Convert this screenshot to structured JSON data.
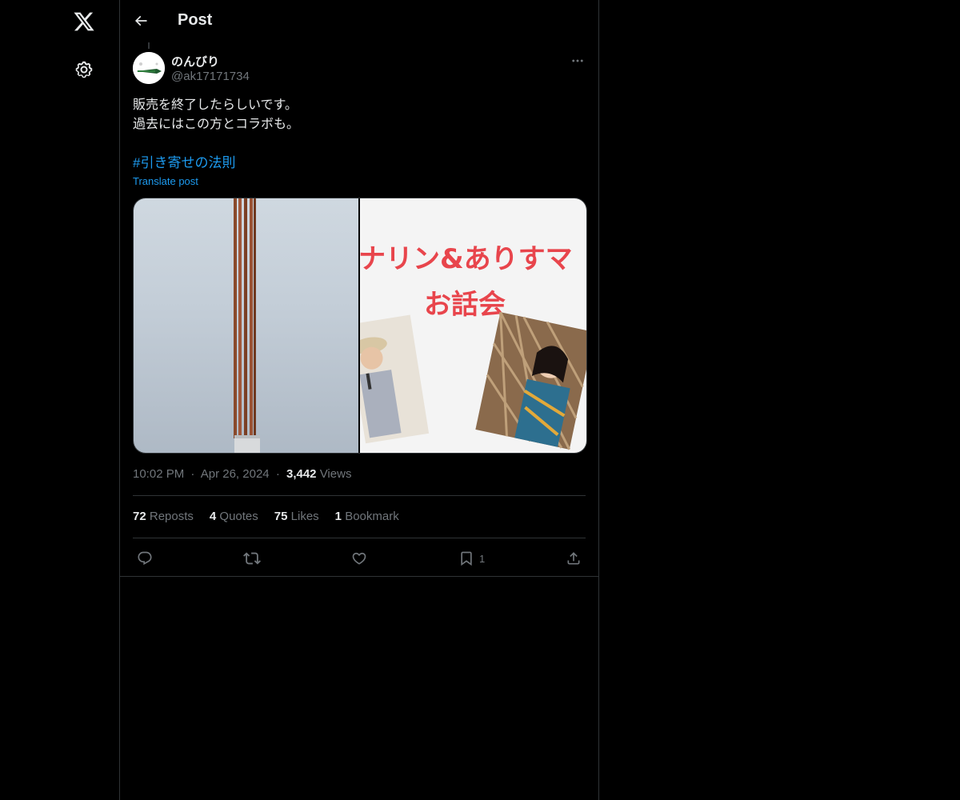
{
  "nav": {
    "logo_icon": "x-logo-icon",
    "settings_icon": "gear-icon"
  },
  "header": {
    "title": "Post"
  },
  "post": {
    "author_name": "のんびり",
    "author_handle": "@ak17171734",
    "text_lines": [
      "販売を終了したらしいです。",
      "過去にはこの方とコラボも。"
    ],
    "hashtag": "#引き寄せの法則",
    "translate_label": "Translate post",
    "media_right_text_line1": "ナリン&ありすマ",
    "media_right_text_line2": "お話会",
    "time": "10:02 PM",
    "date": "Apr 26, 2024",
    "views_count": "3,442",
    "views_label": "Views",
    "separator": "·"
  },
  "stats": {
    "reposts_count": "72",
    "reposts_label": "Reposts",
    "quotes_count": "4",
    "quotes_label": "Quotes",
    "likes_count": "75",
    "likes_label": "Likes",
    "bookmarks_count": "1",
    "bookmarks_label": "Bookmark"
  },
  "actions": {
    "bookmark_count": "1"
  },
  "colors": {
    "background": "#000000",
    "text": "#e7e9ea",
    "secondary_text": "#71767b",
    "link": "#1d9bf0",
    "border": "#2f3336",
    "promo_red": "#e8454c"
  }
}
